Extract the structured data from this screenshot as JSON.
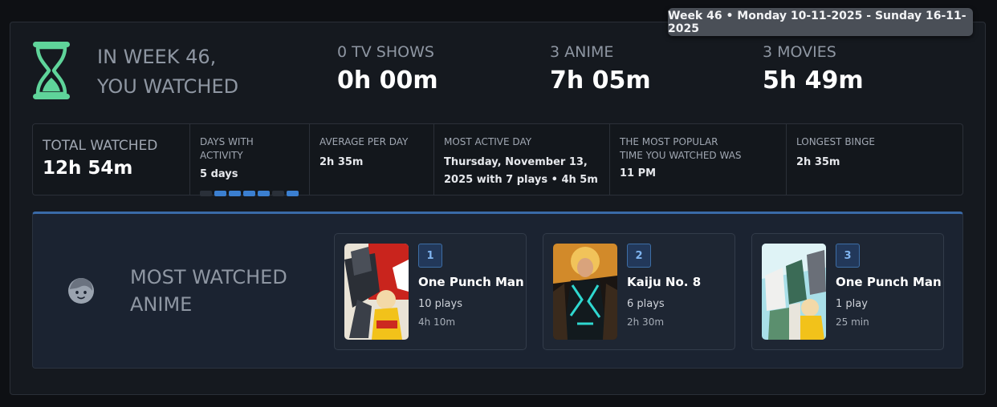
{
  "tooltip": "Week 46 • Monday 10-11-2025 - Sunday 16-11-2025",
  "header": {
    "title_line1": "IN WEEK 46,",
    "title_line2": "YOU WATCHED"
  },
  "stats": [
    {
      "label": "0 TV SHOWS",
      "value": "0h 00m"
    },
    {
      "label": "3 ANIME",
      "value": "7h 05m"
    },
    {
      "label": "3 MOVIES",
      "value": "5h 49m"
    }
  ],
  "metrics": {
    "total": {
      "label": "TOTAL WATCHED",
      "value": "12h 54m"
    },
    "days_active": {
      "label": "DAYS WITH ACTIVITY",
      "value": "5 days",
      "days": [
        false,
        true,
        true,
        true,
        true,
        false,
        true
      ]
    },
    "average": {
      "label": "AVERAGE PER DAY",
      "value": "2h 35m"
    },
    "most_active": {
      "label": "MOST ACTIVE DAY",
      "value_line1": "Thursday, November 13,",
      "value_line2": "2025 with 7 plays • 4h 5m"
    },
    "popular_time": {
      "label_line1": "THE MOST POPULAR",
      "label_line2": "TIME YOU WATCHED WAS",
      "value": "11 PM"
    },
    "longest_binge": {
      "label": "LONGEST BINGE",
      "value": "2h 35m"
    }
  },
  "most_watched": {
    "title_line1": "MOST WATCHED",
    "title_line2": "ANIME",
    "items": [
      {
        "rank": "1",
        "title": "One Punch Man",
        "plays": "10 plays",
        "time": "4h 10m"
      },
      {
        "rank": "2",
        "title": "Kaiju No. 8",
        "plays": "6 plays",
        "time": "2h 30m"
      },
      {
        "rank": "3",
        "title": "One Punch Man",
        "plays": "1 play",
        "time": "25 min"
      }
    ]
  },
  "colors": {
    "accent_green": "#5fd49a",
    "accent_blue": "#3b7fd0",
    "background": "#0e1014"
  }
}
